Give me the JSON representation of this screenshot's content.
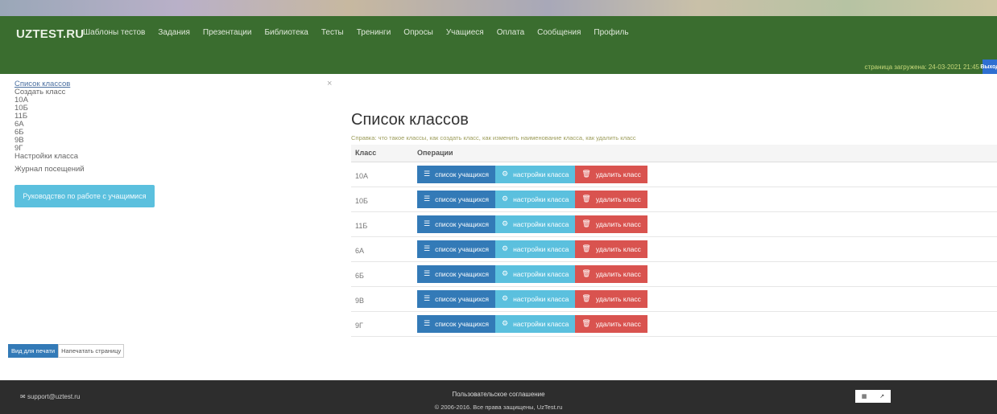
{
  "nav": {
    "brand": "UZTEST.RU",
    "items": [
      "Шаблоны тестов",
      "Задания",
      "Презентации",
      "Библиотека",
      "Тесты",
      "Тренинги",
      "Опросы",
      "Учащиеся",
      "Оплата",
      "Сообщения",
      "Профиль"
    ],
    "updated": "страница загружена: 24-03-2021 21:45",
    "logout_label": "Выход"
  },
  "sidebar": {
    "close": "×",
    "links": [
      "Список классов",
      "Создать класс",
      "10А",
      "10Б",
      "11Б",
      "6А",
      "6Б",
      "9В",
      "9Г",
      "Настройки класса"
    ],
    "journal": "Журнал посещений",
    "guide_button": "Руководство по работе с учащимися"
  },
  "main": {
    "title": "Список классов",
    "help": "Справка: что такое классы, как создать класс, как изменить наименование класса, как удалить класс",
    "columns": [
      "Класс",
      "Операции"
    ],
    "rows": [
      {
        "class": "10А"
      },
      {
        "class": "10Б"
      },
      {
        "class": "11Б"
      },
      {
        "class": "6А"
      },
      {
        "class": "6Б"
      },
      {
        "class": "9В"
      },
      {
        "class": "9Г"
      }
    ],
    "btn_students": "список учащихся",
    "btn_settings": "настройки класса",
    "btn_delete": "удалить класс"
  },
  "print": {
    "print_view": "Вид для печати",
    "print_page": "Напечатать страницу"
  },
  "footer": {
    "email": "support@uztest.ru",
    "agreement": "Пользовательское соглашение",
    "copyright": "© 2006-2016. Все права защищены, UzTest.ru"
  },
  "colors": {
    "nav_bg": "#3a6d2f",
    "btn_students": "#337ab7",
    "btn_settings": "#5bc0de",
    "btn_delete": "#d9534f",
    "footer_bg": "#2d2d2d"
  }
}
